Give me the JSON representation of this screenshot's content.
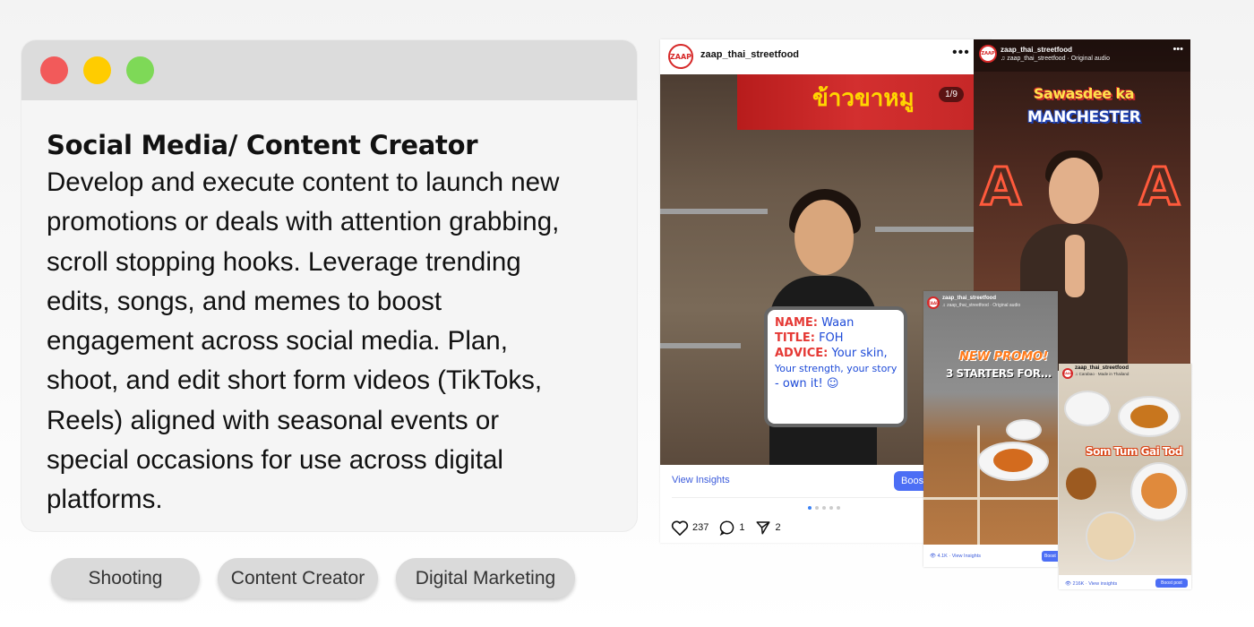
{
  "window": {
    "controls": [
      "close",
      "minimize",
      "maximize"
    ],
    "colors": {
      "close": "#f25a5a",
      "minimize": "#ffcc00",
      "maximize": "#7ed957"
    }
  },
  "card": {
    "title": "Social Media/ Content Creator",
    "body_lines": [
      "Develop and execute content to launch new",
      "promotions or deals with attention grabbing,",
      "scroll stopping hooks. Leverage trending",
      "edits, songs, and memes to boost",
      "engagement across social media. Plan,",
      "shoot, and edit short form videos (TikToks,",
      "Reels) aligned with seasonal events or",
      "special occasions for use across digital",
      "platforms."
    ]
  },
  "tags": [
    "Shooting",
    "Content Creator",
    "Digital Marketing"
  ],
  "post_main": {
    "logo_text": "ZAAP",
    "username": "zaap_thai_streetfood",
    "more": "•••",
    "counter": "1/9",
    "sign_text": "ข้าวขาหมู",
    "whiteboard": {
      "line1_label": "NAME:",
      "line1_value": "Waan",
      "line2_label": "TITLE:",
      "line2_value": "FOH",
      "line3_label": "ADVICE:",
      "line3_value": "Your skin,",
      "line4": "Your strength, your story",
      "line5": "- own it! ☺"
    },
    "view_insights": "View Insights",
    "boost": "Boost",
    "carousel_dots": 5,
    "likes": "237",
    "comments": "1",
    "shares": "2"
  },
  "post_manchester": {
    "username": "zaap_thai_streetfood",
    "audio": "♫ zaap_thai_streetfood · Original audio",
    "more": "•••",
    "headline1": "Sawasdee ka",
    "headline2": "MANCHESTER"
  },
  "post_promo": {
    "username": "zaap_thai_streetfood",
    "audio": "♫ zaap_thai_streetfood · Original audio",
    "headline1": "NEW PROMO!",
    "headline2": "3 STARTERS FOR...",
    "insights": "👁 4.1K · View Insights",
    "boost": "Boost"
  },
  "post_somtum": {
    "username": "zaap_thai_streetfood",
    "audio": "♫ Carabao · Made in Thailand",
    "headline": "Som Tum Gai Tod",
    "insights": "👁 216K · View insights",
    "boost": "Boost post"
  }
}
